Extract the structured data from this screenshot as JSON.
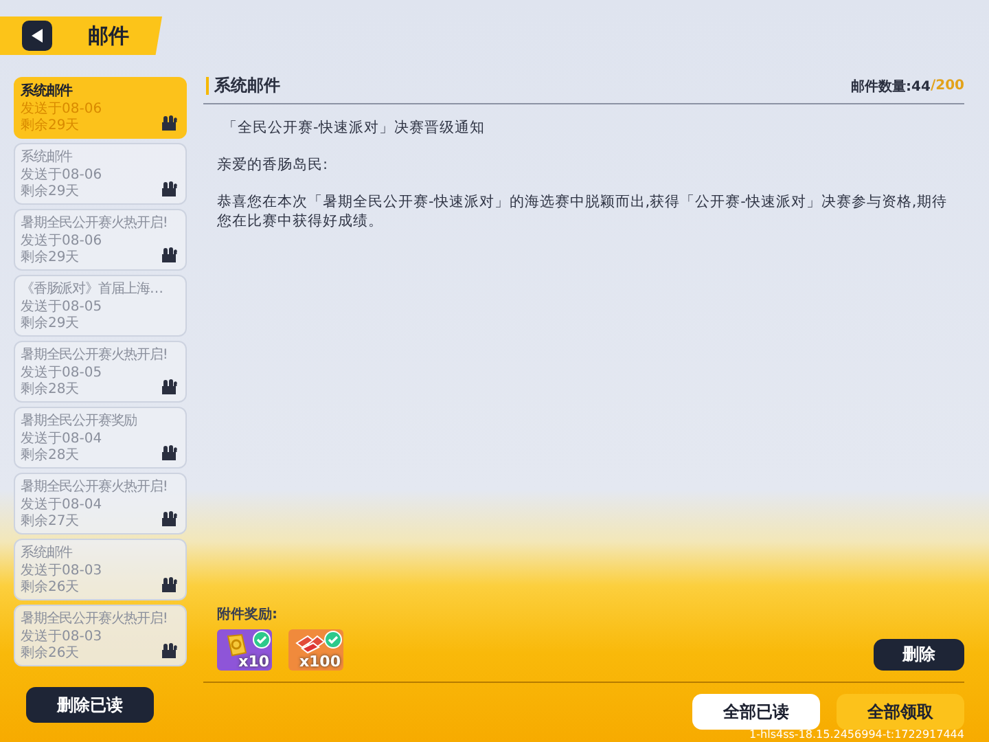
{
  "header": {
    "title": "邮件"
  },
  "mail_list": [
    {
      "title": "系统邮件",
      "sent": "发送于08-06",
      "remaining": "剩余29天",
      "selected": true,
      "has_attachment": true
    },
    {
      "title": "系统邮件",
      "sent": "发送于08-06",
      "remaining": "剩余29天",
      "selected": false,
      "has_attachment": true
    },
    {
      "title": "暑期全民公开赛火热开启!",
      "sent": "发送于08-06",
      "remaining": "剩余29天",
      "selected": false,
      "has_attachment": true
    },
    {
      "title": "《香肠派对》首届上海…",
      "sent": "发送于08-05",
      "remaining": "剩余29天",
      "selected": false,
      "has_attachment": false
    },
    {
      "title": "暑期全民公开赛火热开启!",
      "sent": "发送于08-05",
      "remaining": "剩余28天",
      "selected": false,
      "has_attachment": true
    },
    {
      "title": "暑期全民公开赛奖励",
      "sent": "发送于08-04",
      "remaining": "剩余28天",
      "selected": false,
      "has_attachment": true
    },
    {
      "title": "暑期全民公开赛火热开启!",
      "sent": "发送于08-04",
      "remaining": "剩余27天",
      "selected": false,
      "has_attachment": true
    },
    {
      "title": "系统邮件",
      "sent": "发送于08-03",
      "remaining": "剩余26天",
      "selected": false,
      "has_attachment": true
    },
    {
      "title": "暑期全民公开赛火热开启!",
      "sent": "发送于08-03",
      "remaining": "剩余26天",
      "selected": false,
      "has_attachment": true
    }
  ],
  "delete_read_button": "删除已读",
  "detail": {
    "title": "系统邮件",
    "mail_count": "邮件数量:44",
    "mail_capacity": "/200",
    "paragraphs": [
      "「全民公开赛-快速派对」决赛晋级通知",
      "亲爱的香肠岛民:",
      "恭喜您在本次「暑期全民公开赛-快速派对」的海选赛中脱颖而出,获得「公开赛-快速派对」决赛参与资格,期待您在比赛中获得好成绩。"
    ],
    "rewards_label": "附件奖励:",
    "rewards": [
      {
        "kind": "ticket",
        "count": "x10",
        "claimed": true
      },
      {
        "kind": "coupon",
        "count": "x100",
        "claimed": true
      }
    ],
    "delete_button": "删除"
  },
  "footer": {
    "read_all_button": "全部已读",
    "claim_all_button": "全部领取",
    "build_info": "1-hls4ss-18.15.2456994-t:1722917444"
  }
}
